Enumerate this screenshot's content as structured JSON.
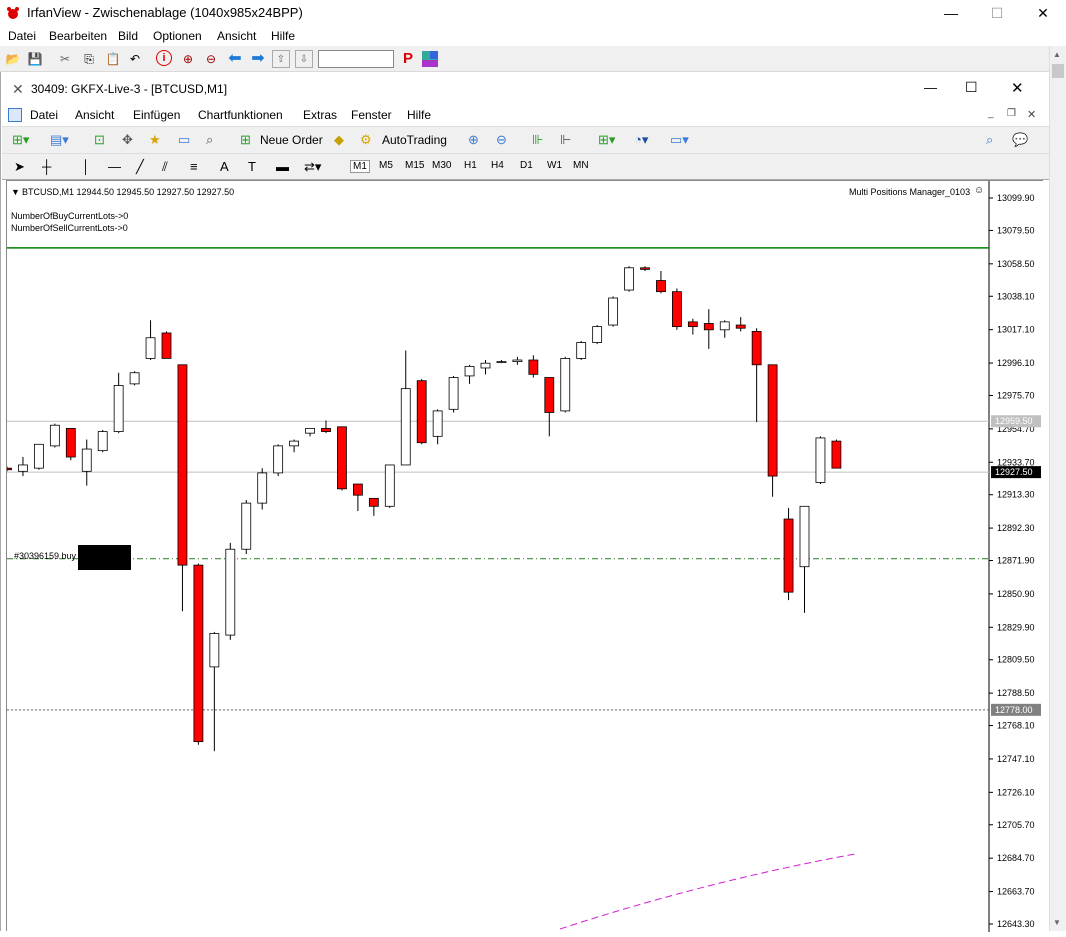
{
  "irfan": {
    "title": "IrfanView - Zwischenablage (1040x985x24BPP)",
    "menu": [
      "Datei",
      "Bearbeiten",
      "Bild",
      "Optionen",
      "Ansicht",
      "Hilfe"
    ],
    "window_controls": [
      "—",
      "☐",
      "✕"
    ]
  },
  "mt4": {
    "window_title": "30409: GKFX-Live-3 - [BTCUSD,M1]",
    "menu": [
      "Datei",
      "Ansicht",
      "Einfügen",
      "Chartfunktionen",
      "Extras",
      "Fenster",
      "Hilfe"
    ],
    "new_order_label": "Neue Order",
    "autotrading_label": "AutoTrading",
    "timeframes": [
      "M1",
      "M5",
      "M15",
      "M30",
      "H1",
      "H4",
      "D1",
      "W1",
      "MN"
    ],
    "active_timeframe": "M1"
  },
  "chart_header": {
    "symbol_line": "BTCUSD,M1  12944.50 12945.50 12927.50 12927.50",
    "indicator": "Multi Positions Manager_0103",
    "buy_lots": "NumberOfBuyCurrentLots->0",
    "sell_lots": "NumberOfSellCurrentLots->0",
    "order_label": "#30396159 buy"
  },
  "chart_data": {
    "type": "candlestick",
    "symbol": "BTCUSD",
    "timeframe": "M1",
    "y_ticks": [
      "13099.90",
      "13079.50",
      "13058.50",
      "13038.10",
      "13017.10",
      "12996.10",
      "12975.70",
      "12954.70",
      "12933.70",
      "12913.30",
      "12892.30",
      "12871.90",
      "12850.90",
      "12829.90",
      "12809.50",
      "12788.50",
      "12768.10",
      "12747.10",
      "12726.10",
      "12705.70",
      "12684.70",
      "12663.70",
      "12643.30"
    ],
    "ylim": [
      12640,
      13110
    ],
    "highlighted_prices": {
      "grey_level": "12959.50",
      "current_price": "12927.50",
      "dotted_level": "12778.00"
    },
    "levels": {
      "green_line": 13068.5,
      "order_line": 12873.0,
      "dotted_line": 12778.0,
      "grey_line": 12959.5,
      "current_line": 12927.5
    },
    "candles": [
      {
        "o": 12930,
        "h": 12931,
        "l": 12928,
        "c": 12929
      },
      {
        "o": 12928,
        "h": 12937,
        "l": 12925,
        "c": 12932
      },
      {
        "o": 12930,
        "h": 12945,
        "l": 12929,
        "c": 12945
      },
      {
        "o": 12944,
        "h": 12958,
        "l": 12943,
        "c": 12957
      },
      {
        "o": 12955,
        "h": 12955,
        "l": 12935,
        "c": 12937
      },
      {
        "o": 12928,
        "h": 12948,
        "l": 12919,
        "c": 12942
      },
      {
        "o": 12941,
        "h": 12954,
        "l": 12940,
        "c": 12953
      },
      {
        "o": 12953,
        "h": 12990,
        "l": 12952,
        "c": 12982
      },
      {
        "o": 12983,
        "h": 12991,
        "l": 12982,
        "c": 12990
      },
      {
        "o": 12999,
        "h": 13023,
        "l": 12998,
        "c": 13012
      },
      {
        "o": 13015,
        "h": 13016,
        "l": 12999,
        "c": 12999
      },
      {
        "o": 12995,
        "h": 12995,
        "l": 12840,
        "c": 12869
      },
      {
        "o": 12869,
        "h": 12870,
        "l": 12756,
        "c": 12758
      },
      {
        "o": 12805,
        "h": 12827,
        "l": 12752,
        "c": 12826
      },
      {
        "o": 12825,
        "h": 12883,
        "l": 12822,
        "c": 12879
      },
      {
        "o": 12879,
        "h": 12910,
        "l": 12876,
        "c": 12908
      },
      {
        "o": 12908,
        "h": 12930,
        "l": 12904,
        "c": 12927
      },
      {
        "o": 12927,
        "h": 12945,
        "l": 12925,
        "c": 12944
      },
      {
        "o": 12944,
        "h": 12948,
        "l": 12940,
        "c": 12947
      },
      {
        "o": 12952,
        "h": 12955,
        "l": 12950,
        "c": 12955
      },
      {
        "o": 12955,
        "h": 12960,
        "l": 12952,
        "c": 12953
      },
      {
        "o": 12956,
        "h": 12956,
        "l": 12916,
        "c": 12917
      },
      {
        "o": 12920,
        "h": 12920,
        "l": 12903,
        "c": 12913
      },
      {
        "o": 12911,
        "h": 12911,
        "l": 12900,
        "c": 12906
      },
      {
        "o": 12906,
        "h": 12932,
        "l": 12905,
        "c": 12932
      },
      {
        "o": 12932,
        "h": 13004,
        "l": 12932,
        "c": 12980
      },
      {
        "o": 12985,
        "h": 12986,
        "l": 12945,
        "c": 12946
      },
      {
        "o": 12950,
        "h": 12967,
        "l": 12945,
        "c": 12966
      },
      {
        "o": 12967,
        "h": 12988,
        "l": 12965,
        "c": 12987
      },
      {
        "o": 12988,
        "h": 12995,
        "l": 12983,
        "c": 12994
      },
      {
        "o": 12993,
        "h": 12998,
        "l": 12989,
        "c": 12996
      },
      {
        "o": 12997,
        "h": 12998,
        "l": 12996,
        "c": 12997
      },
      {
        "o": 12997,
        "h": 13000,
        "l": 12995,
        "c": 12998
      },
      {
        "o": 12998,
        "h": 13001,
        "l": 12987,
        "c": 12989
      },
      {
        "o": 12987,
        "h": 12987,
        "l": 12950,
        "c": 12965
      },
      {
        "o": 12966,
        "h": 13000,
        "l": 12965,
        "c": 12999
      },
      {
        "o": 12999,
        "h": 13010,
        "l": 12998,
        "c": 13009
      },
      {
        "o": 13009,
        "h": 13020,
        "l": 13008,
        "c": 13019
      },
      {
        "o": 13020,
        "h": 13038,
        "l": 13019,
        "c": 13037
      },
      {
        "o": 13042,
        "h": 13057,
        "l": 13041,
        "c": 13056
      },
      {
        "o": 13056,
        "h": 13057,
        "l": 13054,
        "c": 13055
      },
      {
        "o": 13048,
        "h": 13054,
        "l": 13040,
        "c": 13041
      },
      {
        "o": 13041,
        "h": 13043,
        "l": 13017,
        "c": 13019
      },
      {
        "o": 13022,
        "h": 13024,
        "l": 13014,
        "c": 13019
      },
      {
        "o": 13021,
        "h": 13030,
        "l": 13005,
        "c": 13017
      },
      {
        "o": 13017,
        "h": 13023,
        "l": 13012,
        "c": 13022
      },
      {
        "o": 13020,
        "h": 13025,
        "l": 13016,
        "c": 13018
      },
      {
        "o": 13016,
        "h": 13018,
        "l": 12959,
        "c": 12995
      },
      {
        "o": 12995,
        "h": 12995,
        "l": 12912,
        "c": 12925
      },
      {
        "o": 12898,
        "h": 12905,
        "l": 12847,
        "c": 12852
      },
      {
        "o": 12868,
        "h": 12906,
        "l": 12839,
        "c": 12906
      },
      {
        "o": 12921,
        "h": 12950,
        "l": 12920,
        "c": 12949
      },
      {
        "o": 12947,
        "h": 12948,
        "l": 12930,
        "c": 12930
      }
    ]
  }
}
